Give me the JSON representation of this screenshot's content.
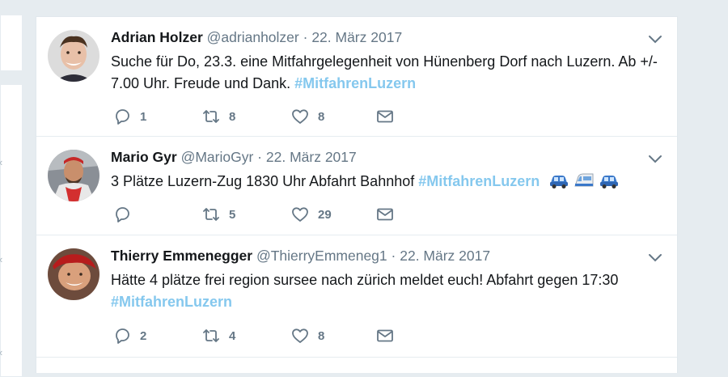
{
  "tweets": [
    {
      "name": "Adrian Holzer",
      "handle": "@adrianholzer",
      "separator": "·",
      "date": "22. März 2017",
      "text": "Suche für Do, 23.3. eine Mitfahrgelegenheit von Hünenberg Dorf nach Luzern. Ab +/- 7.00 Uhr. Freude und Dank.",
      "hashtag": "#MitfahrenLuzern",
      "replies": "1",
      "retweets": "8",
      "likes": "8"
    },
    {
      "name": "Mario Gyr",
      "handle": "@MarioGyr",
      "separator": "·",
      "date": "22. März 2017",
      "text": "3 Plätze Luzern-Zug 1830 Uhr Abfahrt Bahnhof",
      "hashtag": "#MitfahrenLuzern",
      "emojis": [
        "car-emoji",
        "train-emoji",
        "car-emoji"
      ],
      "replies": "",
      "retweets": "5",
      "likes": "29"
    },
    {
      "name": "Thierry Emmenegger",
      "handle": "@ThierryEmmeneg1",
      "separator": "·",
      "date": "22. März 2017",
      "text": "Hätte 4 plätze frei region sursee nach zürich meldet euch! Abfahrt gegen 17:30",
      "hashtag": "#MitfahrenLuzern",
      "replies": "2",
      "retweets": "4",
      "likes": "8"
    }
  ],
  "colors": {
    "hashtag": "#85c8ee",
    "secondary_text": "#657786",
    "icon": "#657786",
    "background": "#e6ecf0"
  }
}
